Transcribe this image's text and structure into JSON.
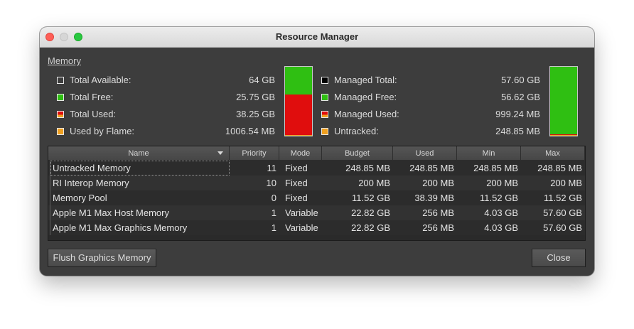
{
  "window": {
    "title": "Resource Manager"
  },
  "memory": {
    "section_label": "Memory",
    "left": [
      {
        "label": "Total Available:",
        "value": "64 GB",
        "swatch": "#3d3d3d"
      },
      {
        "label": "Total Free:",
        "value": "25.75 GB",
        "swatch": "#2fbf12"
      },
      {
        "label": "Total Used:",
        "value": "38.25 GB",
        "swatch": "split"
      },
      {
        "label": "Used by Flame:",
        "value": "1006.54 MB",
        "swatch": "#f0a020"
      }
    ],
    "right": [
      {
        "label": "Managed Total:",
        "value": "57.60 GB",
        "swatch": "#000000"
      },
      {
        "label": "Managed Free:",
        "value": "56.62 GB",
        "swatch": "#2fbf12"
      },
      {
        "label": "Managed Used:",
        "value": "999.24 MB",
        "swatch": "split"
      },
      {
        "label": "Untracked:",
        "value": "248.85 MB",
        "swatch": "#f0a020"
      }
    ],
    "left_bar": {
      "free_pct": 40.2,
      "used_pct": 58.3,
      "flame_pct": 1.5
    },
    "right_bar": {
      "free_pct": 98.3,
      "used_pct": 1.3,
      "untracked_pct": 0.4
    },
    "colors": {
      "free": "#2fbf12",
      "used": "#e00d0d",
      "flame": "#f0a020"
    }
  },
  "table": {
    "columns": [
      "Name",
      "Priority",
      "Mode",
      "Budget",
      "Used",
      "Min",
      "Max"
    ],
    "rows": [
      [
        "Untracked Memory",
        "11",
        "Fixed",
        "248.85 MB",
        "248.85 MB",
        "248.85 MB",
        "248.85 MB"
      ],
      [
        "RI Interop Memory",
        "10",
        "Fixed",
        "200 MB",
        "200 MB",
        "200 MB",
        "200 MB"
      ],
      [
        "Memory Pool",
        "0",
        "Fixed",
        "11.52 GB",
        "38.39 MB",
        "11.52 GB",
        "11.52 GB"
      ],
      [
        "Apple M1 Max Host Memory",
        "1",
        "Variable",
        "22.82 GB",
        "256 MB",
        "4.03 GB",
        "57.60 GB"
      ],
      [
        "Apple M1 Max Graphics Memory",
        "1",
        "Variable",
        "22.82 GB",
        "256 MB",
        "4.03 GB",
        "57.60 GB"
      ]
    ]
  },
  "buttons": {
    "flush": "Flush Graphics Memory",
    "close": "Close"
  }
}
